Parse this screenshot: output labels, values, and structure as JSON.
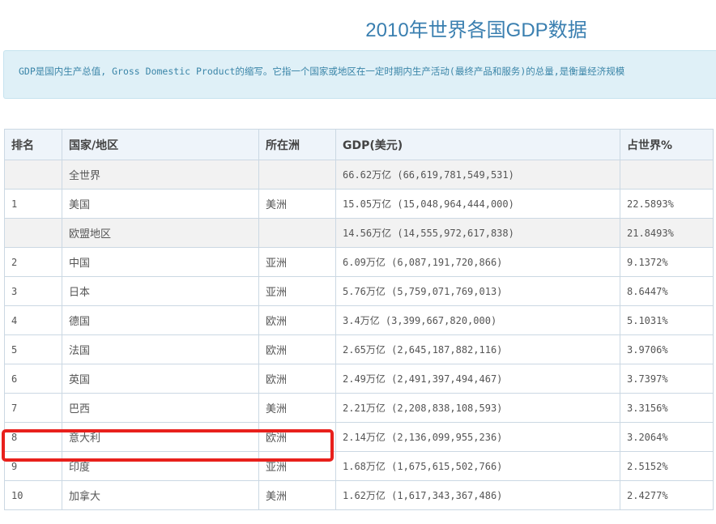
{
  "page": {
    "title": "2010年世界各国GDP数据",
    "description": "GDP是国内生产总值, Gross Domestic Product的缩写。它指一个国家或地区在一定时期内生产活动(最终产品和服务)的总量,是衡量经济规模"
  },
  "table": {
    "headers": [
      "排名",
      "国家/地区",
      "所在洲",
      "GDP(美元)",
      "占世界%"
    ],
    "rows": [
      {
        "rank": "",
        "country": "全世界",
        "continent": "",
        "gdp": "66.62万亿 (66,619,781,549,531)",
        "share": "",
        "shaded": true
      },
      {
        "rank": "1",
        "country": "美国",
        "continent": "美洲",
        "gdp": "15.05万亿 (15,048,964,444,000)",
        "share": "22.5893%",
        "shaded": false
      },
      {
        "rank": "",
        "country": "欧盟地区",
        "continent": "",
        "gdp": "14.56万亿 (14,555,972,617,838)",
        "share": "21.8493%",
        "shaded": true
      },
      {
        "rank": "2",
        "country": "中国",
        "continent": "亚洲",
        "gdp": "6.09万亿 (6,087,191,720,866)",
        "share": "9.1372%",
        "shaded": false
      },
      {
        "rank": "3",
        "country": "日本",
        "continent": "亚洲",
        "gdp": "5.76万亿 (5,759,071,769,013)",
        "share": "8.6447%",
        "shaded": false
      },
      {
        "rank": "4",
        "country": "德国",
        "continent": "欧洲",
        "gdp": "3.4万亿 (3,399,667,820,000)",
        "share": "5.1031%",
        "shaded": false
      },
      {
        "rank": "5",
        "country": "法国",
        "continent": "欧洲",
        "gdp": "2.65万亿 (2,645,187,882,116)",
        "share": "3.9706%",
        "shaded": false
      },
      {
        "rank": "6",
        "country": "英国",
        "continent": "欧洲",
        "gdp": "2.49万亿 (2,491,397,494,467)",
        "share": "3.7397%",
        "shaded": false
      },
      {
        "rank": "7",
        "country": "巴西",
        "continent": "美洲",
        "gdp": "2.21万亿 (2,208,838,108,593)",
        "share": "3.3156%",
        "shaded": false
      },
      {
        "rank": "8",
        "country": "意大利",
        "continent": "欧洲",
        "gdp": "2.14万亿 (2,136,099,955,236)",
        "share": "3.2064%",
        "shaded": false,
        "highlighted": true
      },
      {
        "rank": "9",
        "country": "印度",
        "continent": "亚洲",
        "gdp": "1.68万亿 (1,675,615,502,766)",
        "share": "2.5152%",
        "shaded": false
      },
      {
        "rank": "10",
        "country": "加拿大",
        "continent": "美洲",
        "gdp": "1.62万亿 (1,617,343,367,486)",
        "share": "2.4277%",
        "shaded": false
      }
    ]
  },
  "colors": {
    "title": "#3a7fb0",
    "info_background": "#dff0f7",
    "info_text": "#3a85a8",
    "header_background": "#eef4fa",
    "shaded_row": "#f2f2f2",
    "highlight_border": "#e8201c"
  }
}
